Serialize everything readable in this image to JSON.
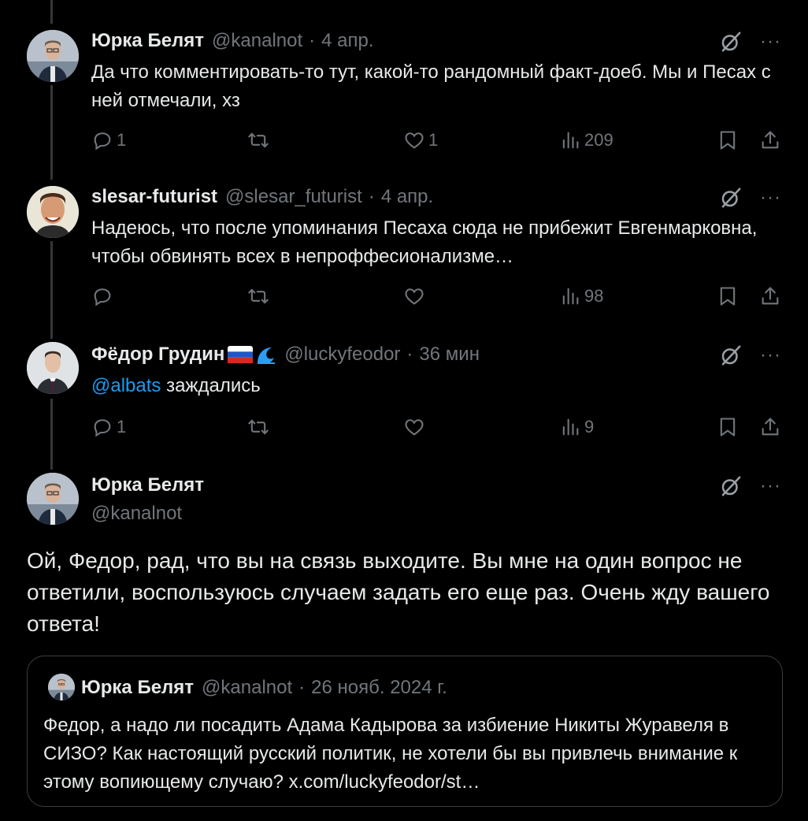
{
  "tweets": [
    {
      "name": "Юрка Белят",
      "handle": "@kanalnot",
      "time": "4 апр.",
      "text": "Да что комментировать-то тут, какой-то рандомный факт-доеб. Мы и Песах с ней отмечали, хз",
      "replies": "1",
      "retweets": "",
      "likes": "1",
      "views": "209"
    },
    {
      "name": "slesar-futurist",
      "handle": "@slesar_futurist",
      "time": "4 апр.",
      "text": "Надеюсь, что после упоминания Песаха сюда не прибежит Евгенмарковна, чтобы обвинять всех в непроффесионализме…",
      "replies": "",
      "retweets": "",
      "likes": "",
      "views": "98"
    },
    {
      "name": "Фёдор Грудин",
      "handle": "@luckyfeodor",
      "time": "36 мин",
      "mention": "@albats",
      "text": " заждались",
      "replies": "1",
      "retweets": "",
      "likes": "",
      "views": "9"
    }
  ],
  "main_tweet": {
    "name": "Юрка Белят",
    "handle": "@kanalnot",
    "text": "Ой, Федор, рад, что вы на связь выходите. Вы мне на один вопрос не ответили, воспользуюсь случаем задать его еще раз. Очень жду вашего ответа!"
  },
  "quote": {
    "name": "Юрка Белят",
    "handle": "@kanalnot",
    "time": "26 нояб. 2024 г.",
    "text": "Федор, а надо ли посадить Адама Кадырова за избиение Никиты Журавеля в СИЗО? Как настоящий русский политик, не хотели бы вы привлечь внимание к этому вопиющему случаю? x.com/luckyfeodor/st…"
  },
  "ui": {
    "dot": "·",
    "more": "···"
  },
  "icons": [
    "reply-icon",
    "retweet-icon",
    "like-icon",
    "views-icon",
    "bookmark-icon",
    "share-icon",
    "grok-icon",
    "more-icon",
    "russia-flag-icon",
    "wave-icon"
  ],
  "colors": {
    "background": "#000000",
    "text": "#e7e9ea",
    "muted": "#71767b",
    "link": "#1d9bf0"
  }
}
